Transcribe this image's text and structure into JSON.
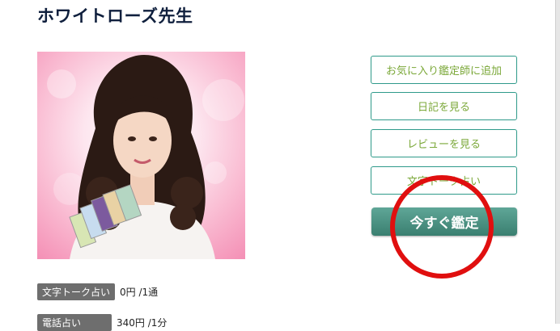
{
  "profile": {
    "name": "ホワイトローズ先生",
    "portrait_alt": "advisor-portrait"
  },
  "actions": {
    "favorite_label": "お気に入り鑑定師に追加",
    "diary_label": "日記を見る",
    "review_label": "レビューを見る",
    "chat_label": "文字トーク占い",
    "consult_now_label": "今すぐ鑑定"
  },
  "prices": [
    {
      "tag": "文字トーク占い",
      "value": "0円 /1通"
    },
    {
      "tag": "電話占い",
      "value": "340円 /1分"
    }
  ],
  "colors": {
    "title": "#0f1f3d",
    "button_border": "#2f9a8a",
    "button_text": "#7ba839",
    "cta_bg": "#4b9282",
    "highlight_circle": "#e00f0f",
    "tag_bg": "#6e6e6e"
  }
}
